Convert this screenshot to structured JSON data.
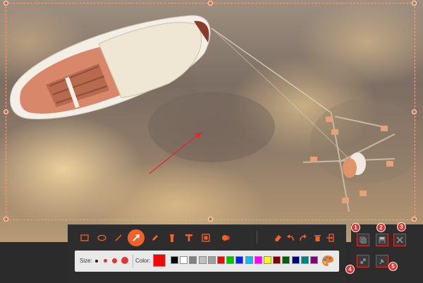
{
  "screenshot": {
    "description_free": true,
    "accent_color": "#f3612b",
    "selection_color": "#e8693c"
  },
  "toolbar": {
    "tools": [
      {
        "name": "rectangle-icon"
      },
      {
        "name": "ellipse-icon"
      },
      {
        "name": "line-icon"
      },
      {
        "name": "arrow-icon",
        "active": true
      },
      {
        "name": "pencil-icon"
      },
      {
        "name": "highlighter-icon"
      },
      {
        "name": "text-icon"
      },
      {
        "name": "mosaic-icon"
      },
      {
        "name": "blur-icon"
      },
      {
        "name": "eraser-icon"
      },
      {
        "name": "undo-icon"
      },
      {
        "name": "redo-icon"
      },
      {
        "name": "delete-icon"
      },
      {
        "name": "exit-icon"
      }
    ],
    "size_label": "Size:",
    "color_label": "Color:",
    "current_color": "#ff0000",
    "swatches": [
      "#000000",
      "#ffffff",
      "#808080",
      "#c0c0c0",
      "#a0a0a0",
      "#ff0000",
      "#00c000",
      "#0020ff",
      "#00c0ff",
      "#ff00ff",
      "#ffff00",
      "#800000",
      "#006000",
      "#000080",
      "#008080",
      "#800080"
    ]
  },
  "actions": [
    {
      "badge": "1",
      "name": "copy-button",
      "icon": "copy-icon"
    },
    {
      "badge": "2",
      "name": "save-button",
      "icon": "save-icon"
    },
    {
      "badge": "3",
      "name": "close-button",
      "icon": "close-icon"
    },
    {
      "badge": "4",
      "name": "fullscreen-button",
      "icon": "expand-icon"
    },
    {
      "badge": "5",
      "name": "pin-button",
      "icon": "pin-icon"
    }
  ]
}
